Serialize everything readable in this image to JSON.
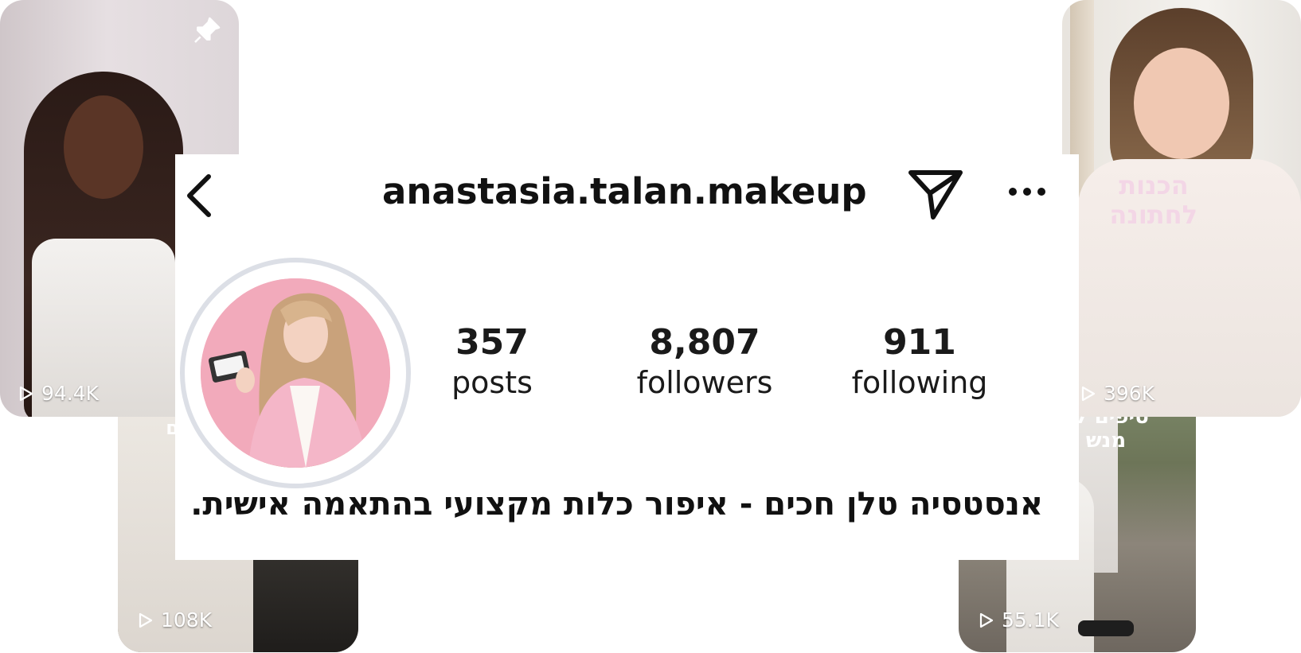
{
  "profile": {
    "username": "anastasia.talan.makeup",
    "bio": "אנסטסיה טלן חכים - איפור כלות מקצועי בהתאמה אישית."
  },
  "stats": {
    "posts": {
      "value": "357",
      "label": "posts"
    },
    "followers": {
      "value": "8,807",
      "label": "followers"
    },
    "following": {
      "value": "911",
      "label": "following"
    }
  },
  "thumbnails": {
    "top_left": {
      "views": "94.4K"
    },
    "bottom_left": {
      "views": "108K",
      "overlay": "לום"
    },
    "top_right": {
      "views": "396K",
      "overlay": "הכנות לחתונה"
    },
    "bottom_right": {
      "views": "55.1K",
      "overlay": "טיפים לכ מנש"
    }
  },
  "icons": {
    "back": "chevron-left-icon",
    "send": "paper-plane-icon",
    "more": "more-horizontal-icon",
    "pin": "pin-icon",
    "play": "play-icon"
  },
  "colors": {
    "avatar_ring": "#dcdfe6",
    "avatar_bg": "#f2aabb",
    "text": "#111111"
  }
}
